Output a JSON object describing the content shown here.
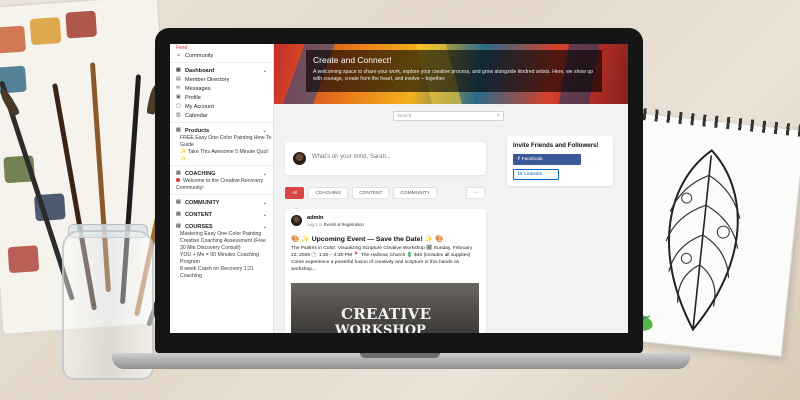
{
  "colors": {
    "accent": "#d94545",
    "facebook": "#3b5998",
    "linkedin": "#0a66c2",
    "hero_overlay": "rgba(0,0,0,0.62)"
  },
  "sidebar": {
    "top_items": [
      {
        "label": "Feed",
        "icon": "feed-icon"
      },
      {
        "label": "Community",
        "icon": "people-icon"
      }
    ],
    "dashboard": {
      "label": "Dashboard",
      "items": [
        "Member Directory",
        "Messages",
        "Profile",
        "My Account",
        "Calendar"
      ]
    },
    "products": {
      "label": "Products",
      "items": [
        "FREE Easy One-Color Painting How-To Guide",
        "✨ Take This Awesome 5 Minute Quiz! ✨"
      ]
    },
    "coaching": {
      "label": "COACHING",
      "items": [
        "Welcome to the Creative Recovery Community!"
      ]
    },
    "community": {
      "label": "COMMUNITY"
    },
    "content": {
      "label": "CONTENT"
    },
    "courses": {
      "label": "COURSES",
      "items": [
        "Mastering Easy One-Color Painting",
        "Creative Coaching Assessment (Free 30 Min Discovery Consult)",
        "YOU + Me = 90 Minutes Coaching Program",
        "8 week Crash on Recovery 1:21 Coaching"
      ]
    }
  },
  "hero": {
    "title": "Create and Connect!",
    "text": "A welcoming space to share your work, explore your creative process, and grow alongside kindred artists. Here, we show up with courage, create from the heart, and evolve -- together."
  },
  "search": {
    "placeholder": "Search"
  },
  "composer": {
    "placeholder": "What's on your mind, Sarah..."
  },
  "filter_tabs": [
    {
      "label": "All",
      "active": true
    },
    {
      "label": "COACHING",
      "active": false
    },
    {
      "label": "CONTENT",
      "active": false
    },
    {
      "label": "COMMUNITY",
      "active": false
    }
  ],
  "more_label": "···",
  "post": {
    "author": "admin",
    "date": "Aug 1",
    "in_label": "in",
    "category": "Events & Registration",
    "title": "Upcoming Event — Save the Date!",
    "title_prefix": "🎨 ✨",
    "title_suffix": "✨ 🎨",
    "body": "The Psalms in Color: Visualizing Scripture Creative Workshop 🗓 Sunday, February 22, 2026 🕐 1:30 – 4:30 PM 📍 The Harbour Church 💲 $40 (includes all supplies) Come experience a powerful fusion of creativity and scripture in this hands-on workshop...",
    "image_text": "CREATIVE",
    "image_text2": "WORKSHOP"
  },
  "invite": {
    "title": "Invite Friends and Followers!",
    "facebook_label": "Facebook",
    "linkedin_label": "LinkedIn"
  }
}
